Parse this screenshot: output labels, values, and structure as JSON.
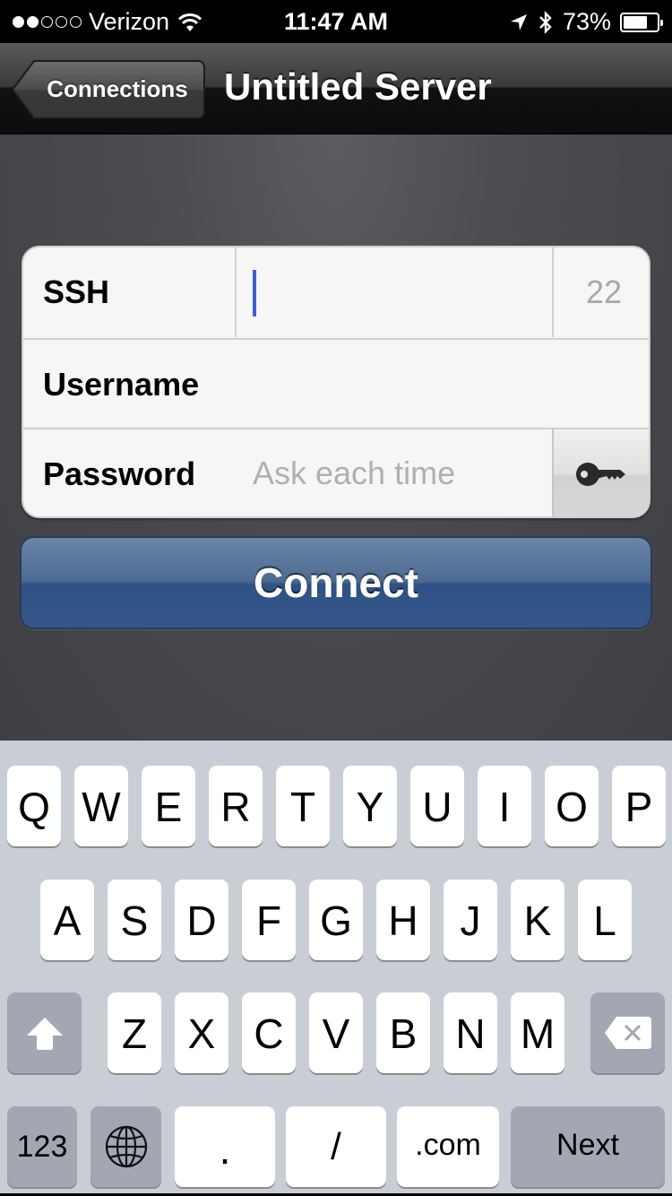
{
  "status_bar": {
    "signal_filled": 2,
    "signal_total": 5,
    "carrier": "Verizon",
    "wifi_icon": "wifi-icon",
    "time": "11:47 AM",
    "location_icon": "location-arrow-icon",
    "bluetooth_icon": "bluetooth-icon",
    "battery_percent_label": "73%",
    "battery_level": 0.73
  },
  "nav": {
    "back_label": "Connections",
    "title": "Untitled Server"
  },
  "form": {
    "protocol_label": "SSH",
    "host_value": "",
    "port_placeholder": "22",
    "username_label": "Username",
    "username_value": "",
    "password_label": "Password",
    "password_placeholder": "Ask each time",
    "key_icon": "key-icon"
  },
  "connect_label": "Connect",
  "keyboard": {
    "row1": [
      "Q",
      "W",
      "E",
      "R",
      "T",
      "Y",
      "U",
      "I",
      "O",
      "P"
    ],
    "row2": [
      "A",
      "S",
      "D",
      "F",
      "G",
      "H",
      "J",
      "K",
      "L"
    ],
    "row3": [
      "Z",
      "X",
      "C",
      "V",
      "B",
      "N",
      "M"
    ],
    "shift_icon": "shift-icon",
    "delete_icon": "backspace-icon",
    "numbers_label": "123",
    "globe_icon": "globe-icon",
    "dot_label": ".",
    "slash_label": "/",
    "dotcom_label": ".com",
    "next_label": "Next"
  },
  "colors": {
    "caret": "#3e5fe0",
    "connect_button": "#35568a",
    "keyboard_bg": "#c9cdd4",
    "special_key": "#a2a7b1"
  }
}
